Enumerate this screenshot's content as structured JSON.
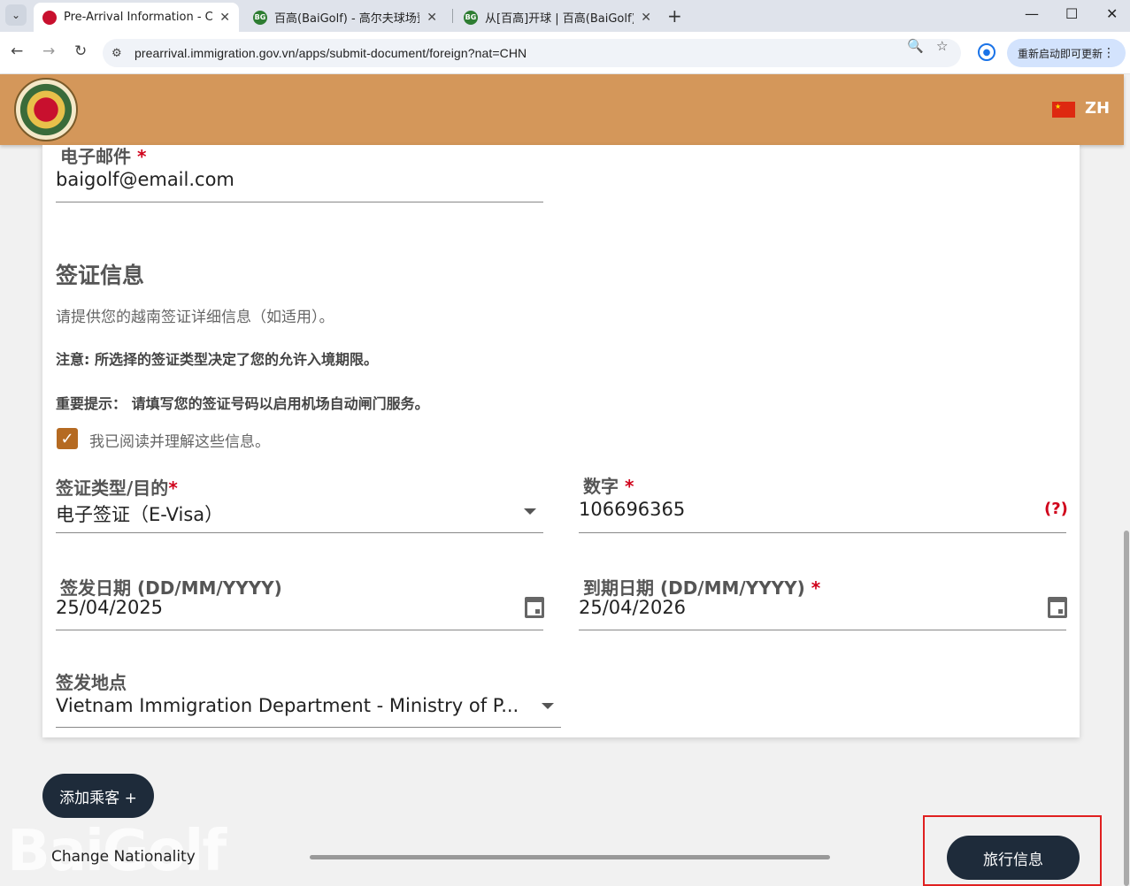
{
  "browser": {
    "tabs": [
      {
        "title": "Pre-Arrival Information - Cục",
        "active": true
      },
      {
        "title": "百高(BaiGolf) - 高尔夫球场预订",
        "active": false
      },
      {
        "title": "从[百高]开球 | 百高(BaiGolf) - 高",
        "active": false
      }
    ],
    "url": "prearrival.immigration.gov.vn/apps/submit-document/foreign?nat=CHN",
    "update_label": "重新启动即可更新"
  },
  "header": {
    "lang": "ZH",
    "flag_icon": "china-flag-icon"
  },
  "form": {
    "email_label": "电子邮件",
    "email_value": "baigolf@email.com",
    "section_title": "签证信息",
    "section_desc": "请提供您的越南签证详细信息（如适用）。",
    "note1": "注意: 所选择的签证类型决定了您的允许入境期限。",
    "note2": "重要提示： 请填写您的签证号码以启用机场自动闸门服务。",
    "ack_label": "我已阅读并理解这些信息。",
    "ack_checked": true,
    "visa_type_label": "签证类型/目的",
    "visa_type_value": "电子签证（E-Visa）",
    "number_label": "数字",
    "number_value": "106696365",
    "number_help": "(?)",
    "issue_date_label": "签发日期 (DD/MM/YYYY)",
    "issue_date_value": "25/04/2025",
    "expiry_date_label": "到期日期 (DD/MM/YYYY)",
    "expiry_date_value": "25/04/2026",
    "issue_place_label": "签发地点",
    "issue_place_value": "Vietnam Immigration Department - Ministry of P...",
    "required_mark": "*"
  },
  "footer": {
    "add_passenger": "添加乘客 +",
    "change_nationality": "Change Nationality",
    "next_button": "旅行信息",
    "watermark": "BaiGolf"
  }
}
